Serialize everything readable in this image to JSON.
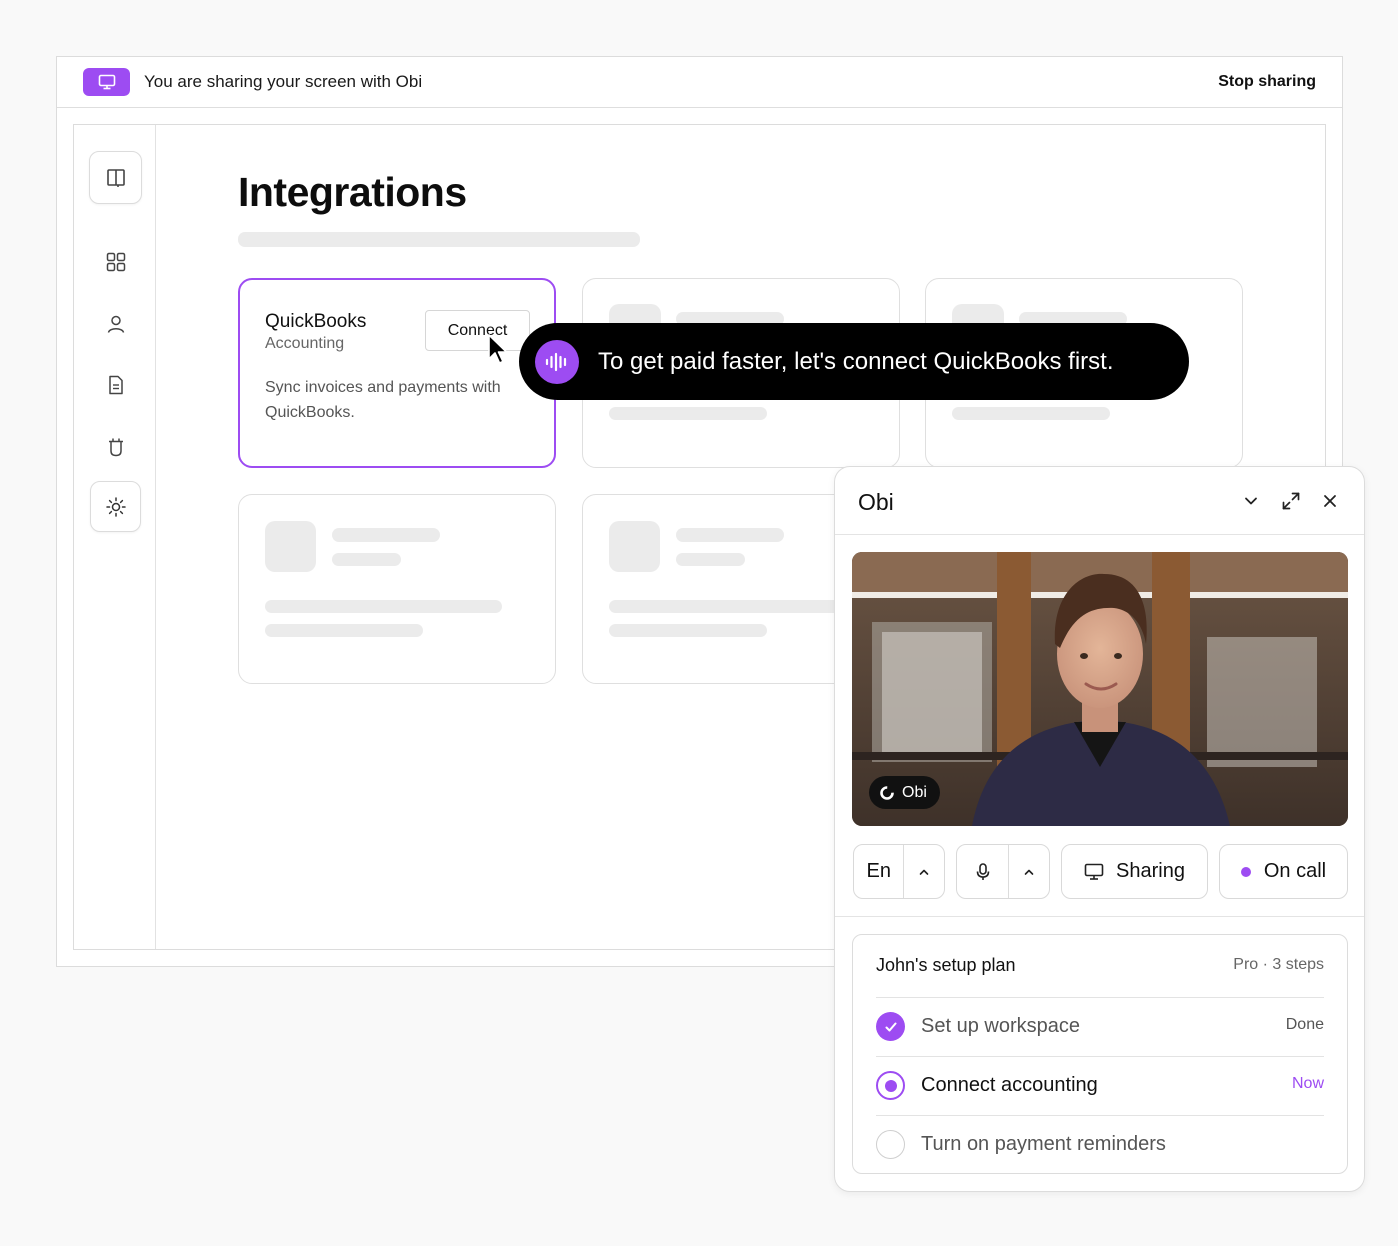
{
  "share_bar": {
    "message": "You are sharing your screen with Obi",
    "stop_label": "Stop sharing",
    "icon": "monitor-icon"
  },
  "sidebar": {
    "items": [
      {
        "icon": "book-open-icon"
      },
      {
        "icon": "grid-icon"
      },
      {
        "icon": "user-icon"
      },
      {
        "icon": "document-icon"
      },
      {
        "icon": "trash-icon"
      },
      {
        "icon": "settings-gear-icon"
      }
    ]
  },
  "main": {
    "title": "Integrations",
    "quickbooks_card": {
      "name": "QuickBooks",
      "category": "Accounting",
      "description": "Sync invoices and payments with QuickBooks.",
      "connect_label": "Connect"
    }
  },
  "tooltip": {
    "text": "To get paid faster, let's connect QuickBooks first.",
    "icon": "voice-wave-icon"
  },
  "obi_panel": {
    "title": "Obi",
    "video_badge": "Obi",
    "controls": {
      "language": "En",
      "sharing_label": "Sharing",
      "call_label": "On call"
    },
    "plan": {
      "title": "John's setup plan",
      "meta": "Pro · 3 steps",
      "steps": [
        {
          "label": "Set up workspace",
          "status": "Done"
        },
        {
          "label": "Connect accounting",
          "status": "Now"
        },
        {
          "label": "Turn on payment reminders",
          "status": ""
        }
      ]
    }
  },
  "colors": {
    "accent": "#9d4cf2",
    "tooltip_bg": "#000000",
    "muted": "#666666",
    "skeleton": "#ebebeb"
  }
}
